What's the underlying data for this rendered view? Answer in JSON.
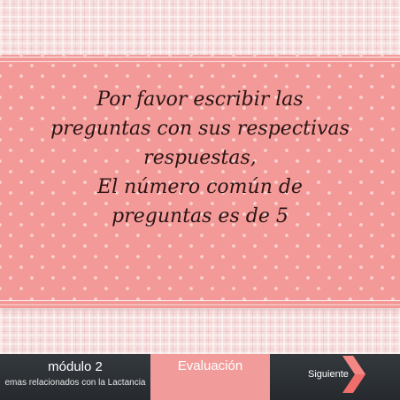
{
  "message": {
    "lines": [
      "Por favor escribir las",
      "preguntas con sus respectivas",
      "respuestas,",
      "El número común de",
      "preguntas es de 5"
    ]
  },
  "nav": {
    "module_title": "módulo 2",
    "module_subtitle": "emas relacionados con la Lactancia",
    "tab_label": "Evaluación",
    "next_label": "Siguiente"
  },
  "colors": {
    "panel": "#f39a98",
    "tab": "#f19c9b",
    "chevron": "#f06e6a",
    "navbar": "#2e3236"
  },
  "icons": {
    "next": "chevron-right-icon"
  }
}
